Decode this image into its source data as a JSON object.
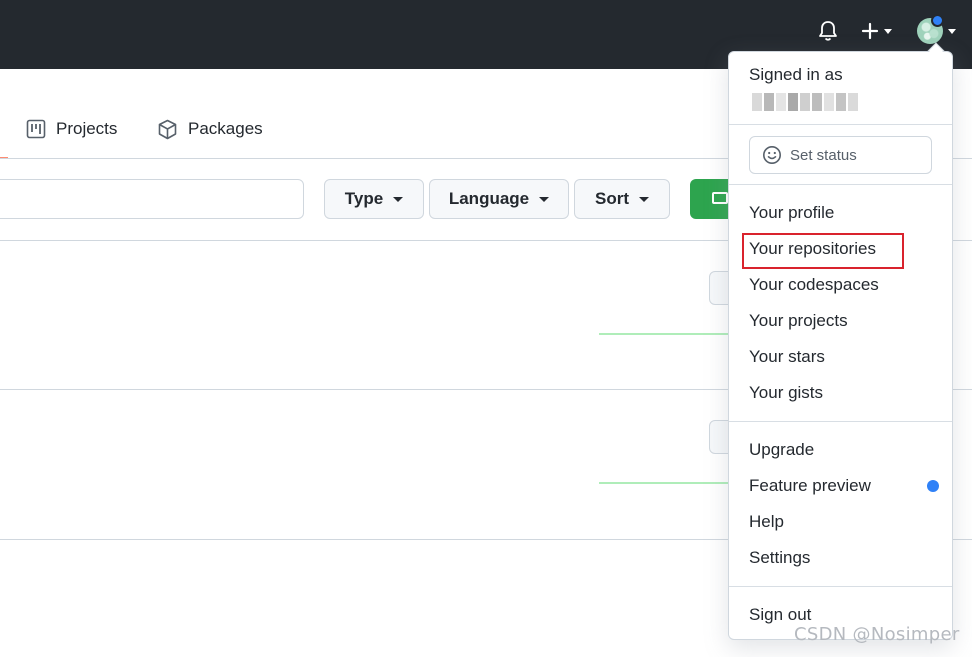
{
  "header": {
    "notifications_icon": "bell-icon",
    "create_icon": "plus-icon",
    "avatar_icon": "avatar"
  },
  "tabs": [
    {
      "label": "Projects",
      "icon": "project-board-icon"
    },
    {
      "label": "Packages",
      "icon": "package-icon"
    }
  ],
  "filters": {
    "search_placeholder": "",
    "type_label": "Type",
    "language_label": "Language",
    "sort_label": "Sort"
  },
  "menu": {
    "signed_in_label": "Signed in as",
    "set_status_label": "Set status",
    "section1": [
      "Your profile",
      "Your repositories",
      "Your codespaces",
      "Your projects",
      "Your stars",
      "Your gists"
    ],
    "section2": [
      "Upgrade",
      "Feature preview",
      "Help",
      "Settings"
    ],
    "sign_out_label": "Sign out"
  },
  "colors": {
    "header_bg": "#24292f",
    "accent_blue": "#2f81f7",
    "green": "#2da44e",
    "highlight_red": "#d9232d"
  },
  "watermark": "CSDN @Nosimper"
}
